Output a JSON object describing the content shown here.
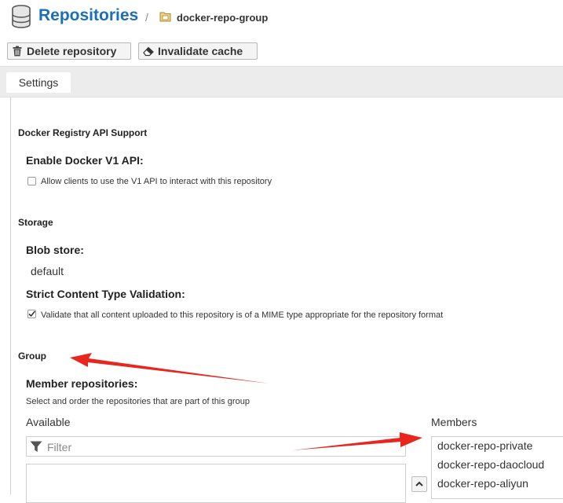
{
  "header": {
    "title": "Repositories",
    "separator": "/",
    "breadcrumb": "docker-repo-group"
  },
  "toolbar": {
    "delete_label": "Delete repository",
    "invalidate_label": "Invalidate cache"
  },
  "tabs": [
    {
      "label": "Settings"
    }
  ],
  "sections": {
    "docker_registry": {
      "title": "Docker Registry API Support",
      "v1_label": "Enable Docker V1 API:",
      "v1_checkbox_text": "Allow clients to use the V1 API to interact with this repository",
      "v1_checked": false
    },
    "storage": {
      "title": "Storage",
      "blob_label": "Blob store:",
      "blob_value": "default",
      "strict_label": "Strict Content Type Validation:",
      "strict_checkbox_text": "Validate that all content uploaded to this repository is of a MIME type appropriate for the repository format",
      "strict_checked": true
    },
    "group": {
      "title": "Group",
      "member_label": "Member repositories:",
      "member_help": "Select and order the repositories that are part of this group",
      "available_label": "Available",
      "members_label": "Members",
      "filter_placeholder": "Filter",
      "members": [
        "docker-repo-private",
        "docker-repo-daocloud",
        "docker-repo-aliyun"
      ]
    }
  },
  "colors": {
    "title_blue": "#1a6fb5",
    "annotation_red": "#e8261e"
  }
}
